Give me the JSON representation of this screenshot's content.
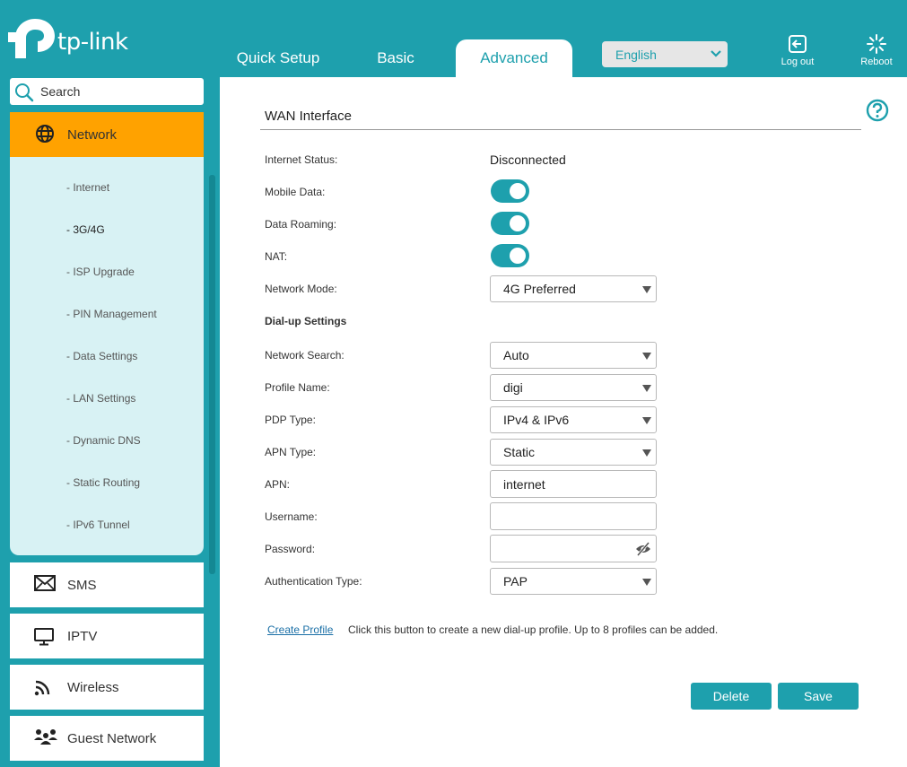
{
  "header": {
    "brand": "tp-link",
    "tabs": [
      {
        "label": "Quick Setup"
      },
      {
        "label": "Basic"
      },
      {
        "label": "Advanced"
      }
    ],
    "language": "English",
    "logout_label": "Log out",
    "reboot_label": "Reboot"
  },
  "sidebar": {
    "search_label": "Search",
    "network_label": "Network",
    "submenu": [
      {
        "label": "- Internet"
      },
      {
        "label": "- 3G/4G"
      },
      {
        "label": "- ISP Upgrade"
      },
      {
        "label": "- PIN Management"
      },
      {
        "label": "- Data Settings"
      },
      {
        "label": "- LAN Settings"
      },
      {
        "label": "- Dynamic DNS"
      },
      {
        "label": "- Static Routing"
      },
      {
        "label": "- IPv6 Tunnel"
      }
    ],
    "items": [
      {
        "label": "SMS",
        "icon": "envelope-icon"
      },
      {
        "label": "IPTV",
        "icon": "monitor-icon"
      },
      {
        "label": "Wireless",
        "icon": "wifi-icon"
      },
      {
        "label": "Guest Network",
        "icon": "guests-icon"
      }
    ]
  },
  "main": {
    "title": "WAN Interface",
    "internet_status": {
      "label": "Internet Status:",
      "value": "Disconnected"
    },
    "mobile_data": {
      "label": "Mobile Data:"
    },
    "data_roaming": {
      "label": "Data Roaming:"
    },
    "nat": {
      "label": "NAT:"
    },
    "network_mode": {
      "label": "Network Mode:",
      "value": "4G Preferred"
    },
    "dialup_heading": "Dial-up Settings",
    "network_search": {
      "label": "Network Search:",
      "value": "Auto"
    },
    "profile_name": {
      "label": "Profile Name:",
      "value": "digi"
    },
    "pdp_type": {
      "label": "PDP Type:",
      "value": "IPv4 & IPv6"
    },
    "apn_type": {
      "label": "APN Type:",
      "value": "Static"
    },
    "apn": {
      "label": "APN:",
      "value": "internet"
    },
    "username": {
      "label": "Username:",
      "value": ""
    },
    "password": {
      "label": "Password:",
      "value": ""
    },
    "auth_type": {
      "label": "Authentication Type:",
      "value": "PAP"
    },
    "create_profile": "Create Profile",
    "create_hint": "Click this button to create a new dial-up profile. Up to 8 profiles can be added.",
    "delete_label": "Delete",
    "save_label": "Save"
  },
  "colors": {
    "accent": "#1ea0ad",
    "active_nav": "#ffa200",
    "submenu_bg": "#d8f2f4"
  }
}
